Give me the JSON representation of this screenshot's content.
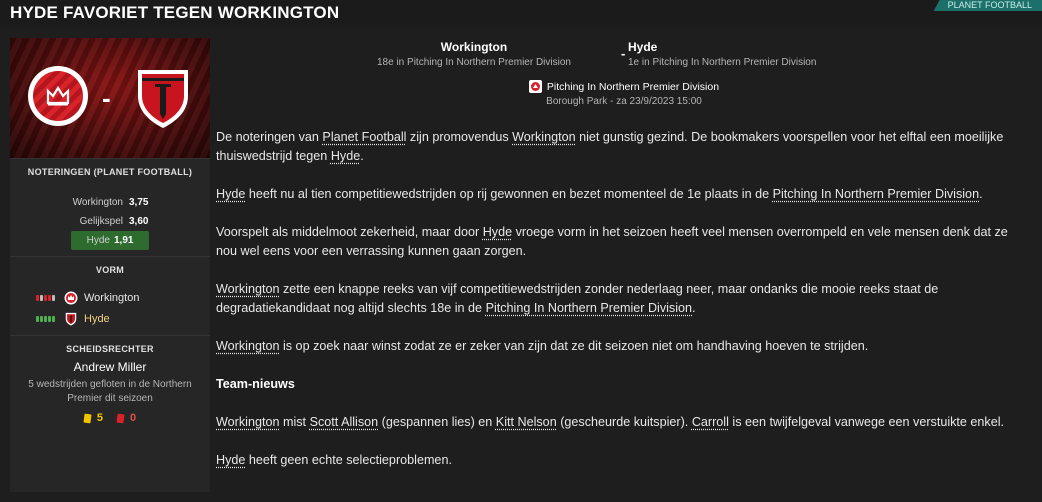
{
  "header": {
    "headline": "HYDE FAVORIET TEGEN WORKINGTON",
    "source": "PLANET FOOTBALL"
  },
  "sidebar": {
    "odds_title": "NOTERINGEN (PLANET FOOTBALL)",
    "odds": [
      {
        "label": "Workington",
        "value": "3,75"
      },
      {
        "label": "Gelijkspel",
        "value": "3,60"
      },
      {
        "label": "Hyde",
        "value": "1,91"
      }
    ],
    "form_title": "VORM",
    "form": [
      {
        "team": "Workington",
        "results": [
          "red",
          "white",
          "red",
          "red",
          "white"
        ]
      },
      {
        "team": "Hyde",
        "results": [
          "green",
          "green",
          "green",
          "green",
          "green"
        ]
      }
    ],
    "ref_title": "SCHEIDSRECHTER",
    "ref_name": "Andrew Miller",
    "ref_note": "5 wedstrijden gefloten in de Northern Premier dit seizoen",
    "yellow_cards": "5",
    "red_cards": "0"
  },
  "fixture": {
    "home_name": "Workington",
    "home_pos": "18e in Pitching In Northern Premier Division",
    "away_name": "Hyde",
    "away_pos": "1e in Pitching In Northern Premier Division",
    "separator": "-",
    "competition": "Pitching In Northern Premier Division",
    "venue": "Borough Park - za 23/9/2023 15:00"
  },
  "article": {
    "p1": [
      "De noteringen van ",
      "Planet Football",
      " zijn promovendus ",
      "Workington",
      " niet gunstig gezind. De bookmakers voorspellen voor het elftal een moeilijke thuiswedstrijd tegen ",
      "Hyde",
      "."
    ],
    "p2": [
      "Hyde",
      " heeft nu al tien competitiewedstrijden op rij gewonnen en bezet momenteel de 1e plaats in de ",
      "Pitching In Northern Premier Division",
      "."
    ],
    "p3": [
      "Voorspelt als middelmoot zekerheid, maar door ",
      "Hyde",
      " vroege vorm in het seizoen heeft veel mensen overrompeld en vele mensen denk dat ze nou wel eens voor een verrassing kunnen gaan zorgen."
    ],
    "p4": [
      "Workington",
      " zette een knappe reeks van vijf competitiewedstrijden zonder nederlaag neer, maar ondanks die mooie reeks staat de degradatiekandidaat nog altijd slechts 18e in de ",
      "Pitching In Northern Premier Division",
      "."
    ],
    "p5": [
      "Workington",
      " is op zoek naar winst zodat ze er zeker van zijn dat ze dit seizoen niet om handhaving hoeven te strijden."
    ],
    "team_news_title": "Team-nieuws",
    "p6": [
      "Workington",
      " mist ",
      "Scott Allison",
      " (gespannen lies) en ",
      "Kitt Nelson",
      " (gescheurde kuitspier). ",
      "Carroll",
      " is een twijfelgeval vanwege een verstuikte enkel."
    ],
    "p7": [
      "Hyde",
      " heeft geen echte selectieproblemen."
    ]
  },
  "colors": {
    "background": "#1e1e1e",
    "sidebar": "#262626",
    "source_tag": "#1d6f6a",
    "favourite_odds": "#2e6b2e",
    "workington_red": "#d8232a",
    "hyde_red": "#c8141e"
  },
  "icons": [
    "workington-crest-icon",
    "hyde-crest-icon",
    "competition-icon",
    "yellow-card-icon",
    "red-card-icon"
  ]
}
